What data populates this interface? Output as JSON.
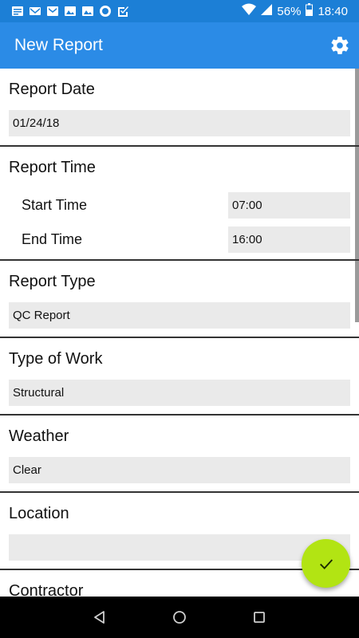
{
  "status_bar": {
    "battery": "56%",
    "time": "18:40",
    "icons": [
      "notification-icon",
      "gmail-icon",
      "gmail-icon",
      "image-icon",
      "image-icon",
      "circle-app-icon",
      "checkbox-app-icon",
      "wifi-icon",
      "signal-icon",
      "battery-icon"
    ]
  },
  "app_bar": {
    "title": "New Report",
    "settings_icon": "gear-icon"
  },
  "sections": {
    "report_date": {
      "title": "Report Date",
      "value": "01/24/18"
    },
    "report_time": {
      "title": "Report Time",
      "start_label": "Start Time",
      "start_value": "07:00",
      "end_label": "End Time",
      "end_value": "16:00"
    },
    "report_type": {
      "title": "Report Type",
      "value": "QC Report"
    },
    "type_of_work": {
      "title": "Type of Work",
      "value": "Structural"
    },
    "weather": {
      "title": "Weather",
      "value": "Clear"
    },
    "location": {
      "title": "Location",
      "value": ""
    },
    "contractor": {
      "title": "Contractor"
    }
  },
  "fab": {
    "icon": "checkmark-icon",
    "color": "#b2e413"
  },
  "nav_bar": {
    "icons": [
      "back-icon",
      "home-icon",
      "recents-icon"
    ]
  },
  "colors": {
    "status_bar": "#1c7fd6",
    "app_bar": "#2b8be6",
    "field_bg": "#eaeaea"
  }
}
